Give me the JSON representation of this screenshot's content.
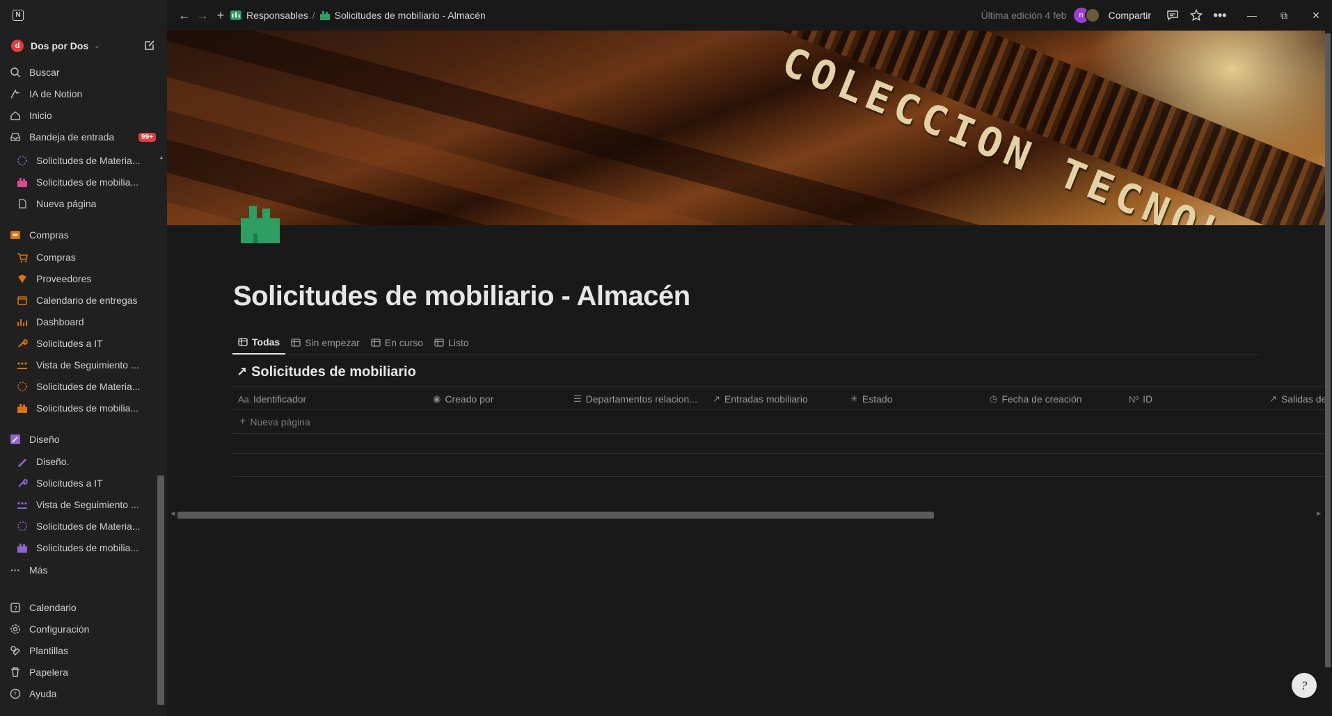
{
  "app": {
    "logo_letter": "N"
  },
  "workspace": {
    "name": "Dos por Dos",
    "avatar_letter": "d"
  },
  "sidebar": {
    "main": [
      {
        "label": "Buscar",
        "icon": "search-icon"
      },
      {
        "label": "IA de Notion",
        "icon": "ai-icon"
      },
      {
        "label": "Inicio",
        "icon": "home-icon"
      },
      {
        "label": "Bandeja de entrada",
        "icon": "inbox-icon",
        "badge": "99+"
      }
    ],
    "pages_a": [
      {
        "label": "Solicitudes de Materia...",
        "icon": "dashed-circle-icon"
      },
      {
        "label": "Solicitudes de mobilia...",
        "icon": "factory-icon"
      },
      {
        "label": "Nueva página",
        "icon": "page-icon"
      }
    ],
    "compras_title": "Compras",
    "compras": [
      {
        "label": "Compras",
        "icon": "cart-icon"
      },
      {
        "label": "Proveedores",
        "icon": "supplier-icon"
      },
      {
        "label": "Calendario de entregas",
        "icon": "calendar-icon"
      },
      {
        "label": "Dashboard",
        "icon": "dashboard-icon"
      },
      {
        "label": "Solicitudes a IT",
        "icon": "wrench-icon"
      },
      {
        "label": "Vista de Seguimiento ...",
        "icon": "team-icon"
      },
      {
        "label": "Solicitudes de Materia...",
        "icon": "dashed-circle-icon"
      },
      {
        "label": "Solicitudes de mobilia...",
        "icon": "factory-icon"
      }
    ],
    "diseno_title": "Diseño",
    "diseno": [
      {
        "label": "Diseño.",
        "icon": "pencil-icon"
      },
      {
        "label": "Solicitudes a IT",
        "icon": "wrench-icon"
      },
      {
        "label": "Vista de Seguimiento ...",
        "icon": "team-icon"
      },
      {
        "label": "Solicitudes de Materia...",
        "icon": "dashed-circle-icon"
      },
      {
        "label": "Solicitudes de mobilia...",
        "icon": "factory-icon"
      }
    ],
    "more_label": "Más",
    "bottom": [
      {
        "label": "Calendario",
        "icon": "calendar-icon"
      },
      {
        "label": "Configuración",
        "icon": "gear-icon"
      },
      {
        "label": "Plantillas",
        "icon": "templates-icon"
      },
      {
        "label": "Papelera",
        "icon": "trash-icon"
      },
      {
        "label": "Ayuda",
        "icon": "help-icon"
      }
    ]
  },
  "topbar": {
    "breadcrumb_parent": "Responsables",
    "breadcrumb_sep": "/",
    "breadcrumb_current": "Solicitudes de mobiliario - Almacén",
    "last_edited": "Última edición 4 feb",
    "avatar_letter": "n",
    "share_label": "Compartir"
  },
  "cover": {
    "engraving": "COLECCION TECNOLOGIA"
  },
  "page": {
    "title": "Solicitudes de mobiliario - Almacén",
    "tabs": [
      {
        "label": "Todas",
        "active": true
      },
      {
        "label": "Sin empezar"
      },
      {
        "label": "En curso"
      },
      {
        "label": "Listo"
      }
    ],
    "database_title": "Solicitudes de mobiliario",
    "columns": [
      {
        "icon_text": "Aa",
        "label": "Identificador"
      },
      {
        "icon_text": "◉",
        "label": "Creado por"
      },
      {
        "icon_text": "☰",
        "label": "Departamentos relacion..."
      },
      {
        "icon_text": "↗",
        "label": "Entradas mobiliario"
      },
      {
        "icon_text": "✳",
        "label": "Estado"
      },
      {
        "icon_text": "◷",
        "label": "Fecha de creación"
      },
      {
        "icon_text": "Nº",
        "label": "ID"
      },
      {
        "icon_text": "↗",
        "label": "Salidas de"
      }
    ],
    "new_row_label": "Nueva página"
  },
  "colors": {
    "accent_red": "#e03e3e",
    "green_icon": "#2f9e63",
    "purple": "#9065d0",
    "orange": "#d9730d"
  }
}
